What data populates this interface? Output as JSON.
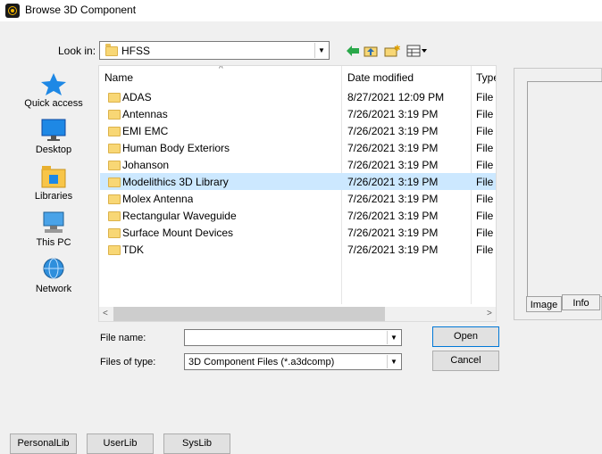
{
  "window": {
    "title": "Browse 3D Component"
  },
  "look_in": {
    "label": "Look in:",
    "value": "HFSS"
  },
  "toolbar": {
    "icons": [
      "back-arrow-icon",
      "up-folder-icon",
      "new-folder-icon",
      "view-menu-icon"
    ]
  },
  "places": [
    {
      "label": "Quick access",
      "icon": "star-icon"
    },
    {
      "label": "Desktop",
      "icon": "desktop-icon"
    },
    {
      "label": "Libraries",
      "icon": "libraries-icon"
    },
    {
      "label": "This PC",
      "icon": "computer-icon"
    },
    {
      "label": "Network",
      "icon": "network-icon"
    }
  ],
  "columns": {
    "name": "Name",
    "date": "Date modified",
    "type": "Type"
  },
  "files": [
    {
      "name": "ADAS",
      "date": "8/27/2021 12:09 PM",
      "type": "File fo",
      "selected": false
    },
    {
      "name": "Antennas",
      "date": "7/26/2021 3:19 PM",
      "type": "File fo",
      "selected": false
    },
    {
      "name": "EMI EMC",
      "date": "7/26/2021 3:19 PM",
      "type": "File fo",
      "selected": false
    },
    {
      "name": "Human Body Exteriors",
      "date": "7/26/2021 3:19 PM",
      "type": "File fo",
      "selected": false
    },
    {
      "name": "Johanson",
      "date": "7/26/2021 3:19 PM",
      "type": "File fo",
      "selected": false
    },
    {
      "name": "Modelithics 3D Library",
      "date": "7/26/2021 3:19 PM",
      "type": "File fo",
      "selected": true
    },
    {
      "name": "Molex Antenna",
      "date": "7/26/2021 3:19 PM",
      "type": "File fo",
      "selected": false
    },
    {
      "name": "Rectangular Waveguide",
      "date": "7/26/2021 3:19 PM",
      "type": "File fo",
      "selected": false
    },
    {
      "name": "Surface Mount Devices",
      "date": "7/26/2021 3:19 PM",
      "type": "File fo",
      "selected": false
    },
    {
      "name": "TDK",
      "date": "7/26/2021 3:19 PM",
      "type": "File fo",
      "selected": false
    }
  ],
  "file_name": {
    "label": "File name:",
    "value": ""
  },
  "file_type": {
    "label": "Files of type:",
    "value": "3D Component Files (*.a3dcomp)"
  },
  "buttons": {
    "open": "Open",
    "cancel": "Cancel",
    "personal_lib": "PersonalLib",
    "user_lib": "UserLib",
    "sys_lib": "SysLib"
  },
  "preview_tabs": {
    "image": "Image",
    "info": "Info"
  },
  "colors": {
    "selection": "#cce8ff",
    "folder": "#f8d775",
    "accent": "#0078d7"
  }
}
